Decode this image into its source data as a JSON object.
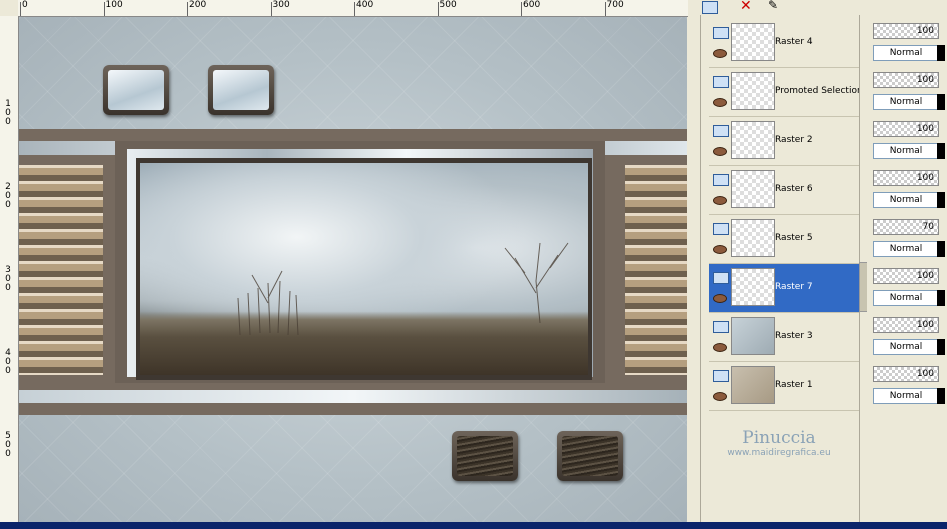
{
  "ruler": {
    "top_labels": [
      "0",
      "100",
      "200",
      "300",
      "400",
      "500",
      "600",
      "700"
    ],
    "left_labels": [
      "1\n0\n0",
      "2\n0\n0",
      "3\n0\n0",
      "4\n0\n0",
      "5\n0\n0"
    ]
  },
  "layers": [
    {
      "name": "Raster 4",
      "opacity": "100",
      "blend": "Normal",
      "selected": false,
      "thumb": "transparent"
    },
    {
      "name": "Promoted Selection",
      "opacity": "100",
      "blend": "Normal",
      "selected": false,
      "thumb": "transparent"
    },
    {
      "name": "Raster 2",
      "opacity": "100",
      "blend": "Normal",
      "selected": false,
      "thumb": "transparent"
    },
    {
      "name": "Raster 6",
      "opacity": "100",
      "blend": "Normal",
      "selected": false,
      "thumb": "transparent"
    },
    {
      "name": "Raster 5",
      "opacity": "70",
      "blend": "Normal",
      "selected": false,
      "thumb": "transparent"
    },
    {
      "name": "Raster 7",
      "opacity": "100",
      "blend": "Normal",
      "selected": true,
      "thumb": "transparent"
    },
    {
      "name": "Raster 3",
      "opacity": "100",
      "blend": "Normal",
      "selected": false,
      "thumb": "pattern"
    },
    {
      "name": "Raster 1",
      "opacity": "100",
      "blend": "Normal",
      "selected": false,
      "thumb": "beige"
    }
  ],
  "watermark": {
    "title": "Pinuccia",
    "url": "www.maidiregrafica.eu"
  },
  "icons": {
    "layer_visibility": "layer-icon",
    "eye": "eye-icon",
    "delete": "delete-x-icon",
    "brush": "brush-icon"
  }
}
